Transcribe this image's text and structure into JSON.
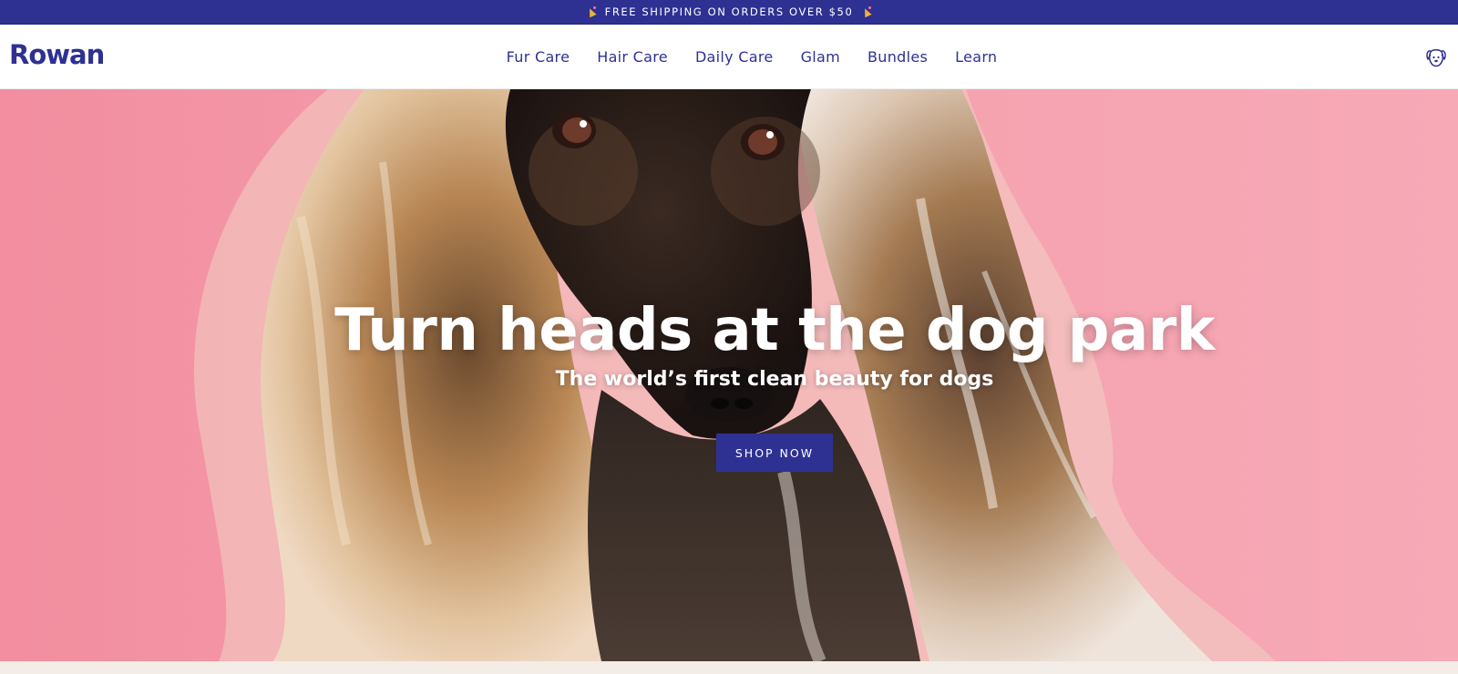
{
  "announcement": {
    "text": "FREE SHIPPING ON ORDERS OVER $50",
    "icon_left": "party-popper-icon",
    "icon_right": "party-popper-icon"
  },
  "header": {
    "logo": "Rowan",
    "nav": [
      {
        "label": "Fur Care"
      },
      {
        "label": "Hair Care"
      },
      {
        "label": "Daily Care"
      },
      {
        "label": "Glam"
      },
      {
        "label": "Bundles"
      },
      {
        "label": "Learn"
      }
    ],
    "account_icon": "dog-face-icon"
  },
  "hero": {
    "headline": "Turn heads at the dog park",
    "subhead": "The world’s first clean beauty for dogs",
    "cta": "SHOP NOW"
  },
  "colors": {
    "brand": "#2e3192",
    "hero_background": "#f29aa8",
    "white": "#ffffff"
  }
}
